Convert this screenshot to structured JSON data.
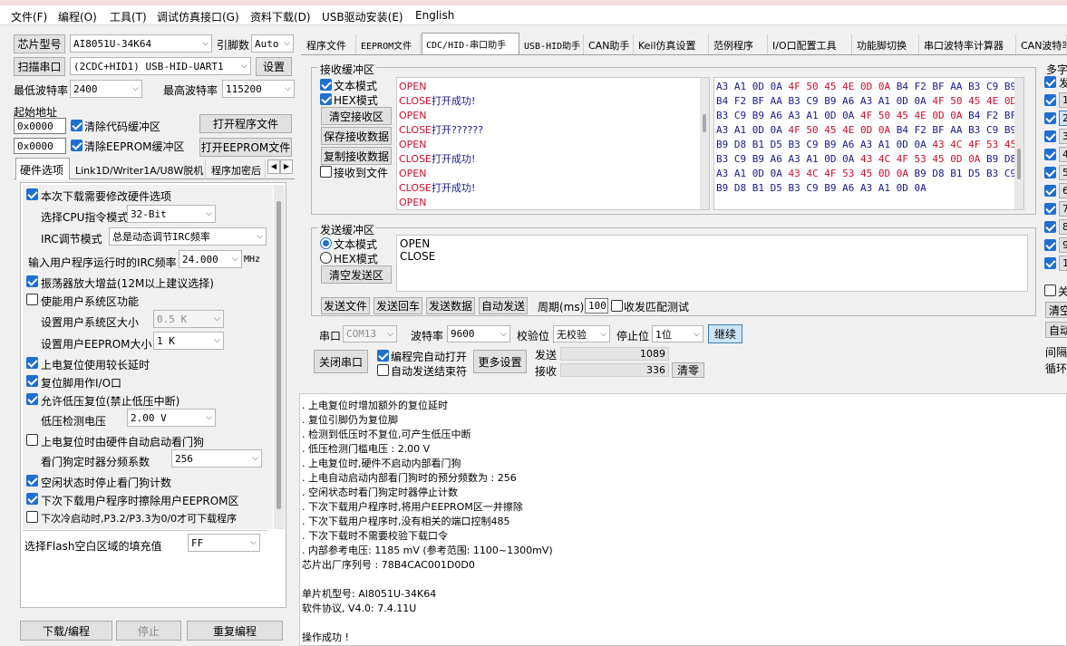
{
  "menu": [
    "文件(F)",
    "编程(O)",
    "工具(T)",
    "调试仿真接口(G)",
    "资料下载(D)",
    "USB驱动安装(E)",
    "English"
  ],
  "left": {
    "chip_btn": "芯片型号",
    "chip_value": "AI8051U-34K64",
    "pins_label": "引脚数",
    "pins_value": "Auto",
    "scan_btn": "扫描串口",
    "port_value": "(2CDC+HID1) USB-HID-UART1",
    "settings_btn": "设置",
    "min_baud_label": "最低波特率",
    "min_baud": "2400",
    "max_baud_label": "最高波特率",
    "max_baud": "115200",
    "start_addr_label": "起始地址",
    "addr1": "0x0000",
    "clear_code": "清除代码缓冲区",
    "open_prog": "打开程序文件",
    "addr2": "0x0000",
    "clear_eeprom": "清除EEPROM缓冲区",
    "open_eeprom": "打开EEPROM文件",
    "tabs": [
      "硬件选项",
      "Link1D/Writer1A/U8W脱机",
      "程序加密后"
    ],
    "hw": {
      "opt_modify": "本次下载需要修改硬件选项",
      "cpu_label": "选择CPU指令模式",
      "cpu_value": "32-Bit",
      "irc_label": "IRC调节模式",
      "irc_value": "总是动态调节IRC频率",
      "freq_label": "输入用户程序运行时的IRC频率",
      "freq_value": "24.000",
      "freq_unit": "MHz",
      "osc_gain": "振荡器放大增益(12M以上建议选择)",
      "user_sys": "使能用户系统区功能",
      "sys_size_label": "设置用户系统区大小",
      "sys_size": "0.5 K",
      "eeprom_size_label": "设置用户EEPROM大小",
      "eeprom_size": "1   K",
      "reset_delay": "上电复位使用较长延时",
      "reset_io": "复位脚用作I/O口",
      "lvr": "允许低压复位(禁止低压中断)",
      "lvd_label": "低压检测电压",
      "lvd_value": "2.00 V",
      "wdt_auto": "上电复位时由硬件自动启动看门狗",
      "wdt_div_label": "看门狗定时器分频系数",
      "wdt_div": "256",
      "idle_wdt": "空闲状态时停止看门狗计数",
      "erase_eeprom": "下次下载用户程序时擦除用户EEPROM区",
      "cold_boot": "下次冷启动时,P3.2/P3.3为0/0才可下载程序",
      "fill_label": "选择Flash空白区域的填充值",
      "fill_value": "FF"
    },
    "download_btn": "下载/编程",
    "stop_btn": "停止",
    "reprog_btn": "重复编程"
  },
  "right_tabs": [
    "程序文件",
    "EEPROM文件",
    "CDC/HID-串口助手",
    "USB-HID助手",
    "CAN助手",
    "Keil仿真设置",
    "范例程序",
    "I/O口配置工具",
    "功能脚切换",
    "串口波特率计算器",
    "CAN波特率"
  ],
  "rx": {
    "title": "接收缓冲区",
    "text_mode": "文本模式",
    "hex_mode": "HEX模式",
    "clear": "清空接收区",
    "save": "保存接收数据",
    "copy": "复制接收数据",
    "to_file": "接收到文件",
    "lines": [
      {
        "t": "OPEN",
        "red": true
      },
      {
        "t": "CLOSE",
        "red": true,
        "s": "打开成功!"
      },
      {
        "t": "OPEN",
        "red": true
      },
      {
        "t": "CLOSE",
        "red": true,
        "s": "打开??????"
      },
      {
        "t": "OPEN",
        "red": true
      },
      {
        "t": "CLOSE",
        "red": true,
        "s": "打开成功!"
      },
      {
        "t": "OPEN",
        "red": true
      },
      {
        "t": "CLOSE",
        "red": true,
        "s": "打开成功!"
      },
      {
        "t": "OPEN",
        "red": true
      }
    ],
    "hex_lines": [
      "A3 A1 0D 0A |4F 50 45 4E 0D 0A| B4 F2 BF AA B3 C9 B9 A6 .",
      "B4 F2 BF AA B3 C9 B9 A6 A3 A1 0D 0A |4F 50 45 4E 0D 0A|",
      "B3 C9 B9 A6 A3 A1 0D 0A |4F 50 45 4E 0D 0A| B4 F2 BF AA :",
      "A3 A1 0D 0A |4F 50 45 4E 0D 0A| B4 F2 BF AA B3 C9 B9 A6",
      "B9 D8 B1 D5 B3 C9 B9 A6 A3 A1 0D 0A |43 4C 4F 53 45 0D|",
      "B3 C9 B9 A6 A3 A1 0D 0A |43 4C 4F 53 45 0D 0A| B9 D8 B1 :",
      "A3 A1 0D 0A |43 4C 4F 53 45 0D 0A| B9 D8 B1 D5 B3 C9 B9 .",
      "B9 D8 B1 D5 B3 C9 B9 A6 A3 A1 0D 0A"
    ]
  },
  "tx": {
    "title": "发送缓冲区",
    "text_mode": "文本模式",
    "hex_mode": "HEX模式",
    "clear": "清空发送区",
    "content": [
      "OPEN",
      "CLOSE"
    ],
    "send_file": "发送文件",
    "send_enter": "发送回车",
    "send_data": "发送数据",
    "auto_send": "自动发送",
    "period_label": "周期(ms)",
    "period": "100",
    "match_test": "收发匹配测试"
  },
  "port": {
    "port_label": "串口",
    "port_value": "COM13",
    "baud_label": "波特率",
    "baud_value": "9600",
    "parity_label": "校验位",
    "parity_value": "无校验",
    "stop_label": "停止位",
    "stop_value": "1位",
    "continue_btn": "继续",
    "close_btn": "关闭串口",
    "auto_open": "编程完自动打开",
    "auto_end": "自动发送结束符",
    "more": "更多设置",
    "send_label": "发送",
    "send_count": "1089",
    "recv_label": "接收",
    "recv_count": "336",
    "clear_count": "清零"
  },
  "far_right": {
    "title": "多字",
    "items": [
      "发",
      "1",
      "2",
      "3",
      "4",
      "5",
      "6",
      "7",
      "8",
      "9",
      "1"
    ],
    "chk": "关",
    "clear": "清空",
    "auto": "自动",
    "interval": "间隔",
    "loop": "循环"
  },
  "log": [
    "  . 上电复位时增加额外的复位延时",
    "  . 复位引脚仍为复位脚",
    "  . 检测到低压时不复位,可产生低压中断",
    "  . 低压检测门槛电压 : 2.00 V",
    "  . 上电复位时,硬件不启动内部看门狗",
    "  . 上电自动启动内部看门狗时的预分频数为 : 256",
    "  . 空闲状态时看门狗定时器停止计数",
    "  . 下次下载用户程序时,将用户EEPROM区一并擦除",
    "  . 下次下载用户程序时,没有相关的端口控制485",
    "  . 下次下载时不需要校验下载口令",
    "  . 内部参考电压: 1185 mV (参考范围: 1100~1300mV)",
    "芯片出厂序列号 : 78B4CAC001D0D0",
    "",
    "  单片机型号: AI8051U-34K64",
    "  软件协议, V4.0: 7.4.11U",
    "",
    "操作成功 !"
  ]
}
